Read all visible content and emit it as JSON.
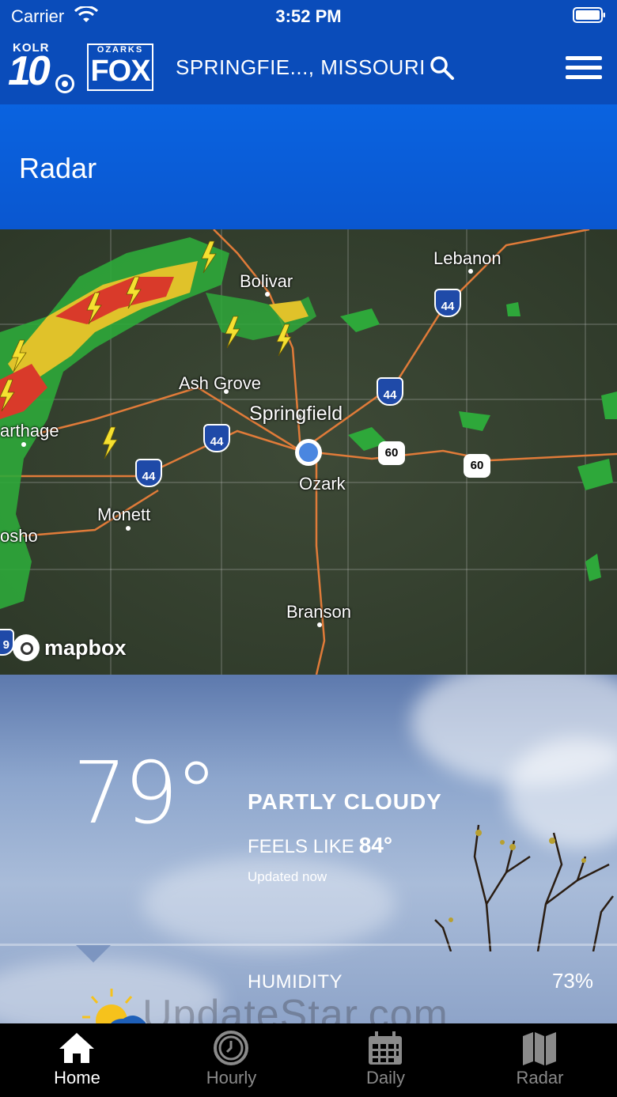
{
  "status": {
    "carrier": "Carrier",
    "time": "3:52 PM"
  },
  "header": {
    "logo1": {
      "top": "KOLR",
      "main": "10"
    },
    "logo2": {
      "top": "OZARKS",
      "main": "FOX"
    },
    "location": "SPRINGFIE..., MISSOURI"
  },
  "page": {
    "title": "Radar"
  },
  "map": {
    "cities": {
      "lebanon": "Lebanon",
      "bolivar": "Bolivar",
      "ash_grove": "Ash Grove",
      "springfield": "Springfield",
      "carthage": "arthage",
      "ozark": "Ozark",
      "monett": "Monett",
      "neosho": "osho",
      "branson": "Branson"
    },
    "shields": {
      "i44": "44",
      "us60": "60",
      "i49": "9"
    },
    "attribution": "mapbox"
  },
  "current": {
    "temperature": "79°",
    "condition": "PARTLY CLOUDY",
    "feels_like_label": "FEELS LIKE",
    "feels_like_value": "84°",
    "updated": "Updated now"
  },
  "details": {
    "humidity_label": "HUMIDITY",
    "humidity_value": "73%"
  },
  "watermark": "UpdateStar.com",
  "tabs": [
    {
      "label": "Home",
      "icon": "home-icon",
      "active": true
    },
    {
      "label": "Hourly",
      "icon": "clock-icon",
      "active": false
    },
    {
      "label": "Daily",
      "icon": "calendar-icon",
      "active": false
    },
    {
      "label": "Radar",
      "icon": "map-icon",
      "active": false
    }
  ],
  "colors": {
    "header": "#0a4cba",
    "band": "#0a63e0",
    "active_tab": "#ffffff",
    "inactive_tab": "#8a8a8a"
  }
}
